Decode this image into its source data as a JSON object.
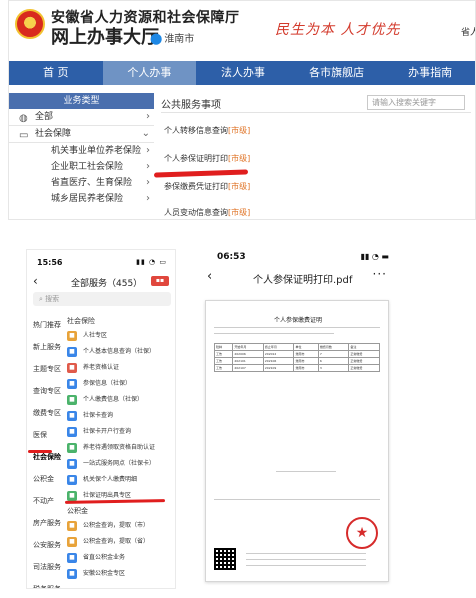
{
  "website": {
    "title": "安徽省人力资源和社会保障厅",
    "subtitle": "网上办事大厅",
    "location": "淮南市",
    "slogan": "民生为本 人才优先",
    "tail_text": "省人",
    "nav": [
      "首 页",
      "个人办事",
      "法人办事",
      "各市旗舰店",
      "办事指南"
    ],
    "sidebar": {
      "header": "业务类型",
      "items": [
        {
          "label": "全部",
          "icon": "globe-icon"
        },
        {
          "label": "社会保障",
          "icon": "id-card-icon"
        },
        {
          "label": "机关事业单位养老保险"
        },
        {
          "label": "企业职工社会保险"
        },
        {
          "label": "省直医疗、生育保险"
        },
        {
          "label": "城乡居民养老保险"
        }
      ]
    },
    "content": {
      "title": "公共服务事项",
      "search_placeholder": "请输入搜索关键字",
      "services": [
        {
          "name": "个人转移信息查询",
          "tag": "[市级]"
        },
        {
          "name": "个人参保证明打印",
          "tag": "[市级]"
        },
        {
          "name": "参保缴费凭证打印",
          "tag": "[市级]"
        },
        {
          "name": "人员变动信息查询",
          "tag": "[市级]"
        }
      ]
    }
  },
  "phone_app": {
    "time": "15:56",
    "title": "全部服务（455）",
    "search_placeholder": "搜索",
    "categories": [
      "热门推荐",
      "新上服务",
      "主题专区",
      "查询专区",
      "缴费专区",
      "医保",
      "社会保险",
      "公积金",
      "不动产",
      "房产服务",
      "公安服务",
      "司法服务",
      "税务服务"
    ],
    "section1": "社会保险",
    "items": [
      {
        "label": "人社专区",
        "color": "#e8a33a"
      },
      {
        "label": "个人基本信息查询（社保）",
        "color": "#3a86e8"
      },
      {
        "label": "养老资格认证",
        "color": "#e05a4a"
      },
      {
        "label": "参保信息（社保）",
        "color": "#3a86e8"
      },
      {
        "label": "个人缴费信息（社保）",
        "color": "#4bb36b"
      },
      {
        "label": "社保卡查询",
        "color": "#3a86e8"
      },
      {
        "label": "社保卡开户行查询",
        "color": "#3a86e8"
      },
      {
        "label": "养老待遇领取资格自助认证",
        "color": "#4bb36b"
      },
      {
        "label": "一站式服务网点（社保卡）",
        "color": "#3a86e8"
      },
      {
        "label": "机关保个人缴费明细",
        "color": "#3a86e8"
      },
      {
        "label": "社保证明出具专区",
        "color": "#4bb36b"
      }
    ],
    "section2": "公积金",
    "items2": [
      {
        "label": "公积金查询，提取（市）",
        "color": "#e8a33a"
      },
      {
        "label": "公积金查询，提取（省）",
        "color": "#e8a33a"
      },
      {
        "label": "省直公积金业务",
        "color": "#3a86e8"
      },
      {
        "label": "安徽公积金专区",
        "color": "#3a86e8"
      }
    ]
  },
  "pdf_view": {
    "time": "06:53",
    "title": "个人参保证明打印.pdf",
    "doc_title": "个人参保缴费证明",
    "table_rows": [
      [
        "险种",
        "开始年月",
        "终止年月",
        "单位",
        "缴费月数",
        "备注"
      ],
      [
        "工伤",
        "202006",
        "202012",
        "淮南市",
        "7",
        "正常缴费"
      ],
      [
        "工伤",
        "202101",
        "202106",
        "淮南市",
        "6",
        "正常缴费"
      ],
      [
        "工伤",
        "202107",
        "202109",
        "淮南市",
        "3",
        "正常缴费"
      ]
    ],
    "stamp": "★"
  }
}
